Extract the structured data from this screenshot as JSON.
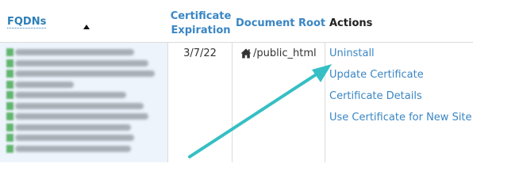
{
  "table": {
    "headers": {
      "fqdns": "FQDNs",
      "certificate_expiration": [
        "Certificate",
        "Expiration"
      ],
      "document_root": "Document Root",
      "actions": "Actions"
    },
    "rows": [
      {
        "certificate_expiration": "3/7/22",
        "document_root": "/public_html",
        "document_root_icon": "home-icon",
        "actions": [
          "Uninstall",
          "Update Certificate",
          "Certificate Details",
          "Use Certificate for New Site"
        ]
      }
    ]
  },
  "annotation": {
    "arrow_color": "#35bfc4",
    "points_to": "Uninstall"
  },
  "colors": {
    "link": "#3a86c4",
    "fqdn_bg": "#eef4fc",
    "border": "#dcdcdc"
  }
}
